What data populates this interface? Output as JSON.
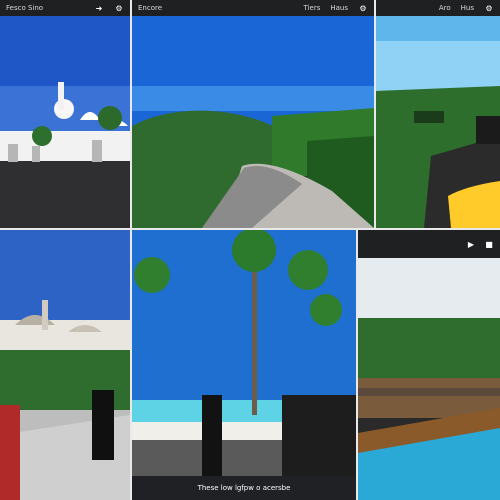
{
  "panels": [
    {
      "toolbar": {
        "label_left": "Fesco Sino",
        "label_right": ""
      }
    },
    {
      "toolbar": {
        "label_left": "Encore",
        "label_mid": "Tiers",
        "label_right": "Haus"
      }
    },
    {
      "toolbar": {
        "label_left": "",
        "label_mid": "Aro",
        "label_right": "Hus"
      }
    },
    {
      "caption": "These low lgfpw o acersbe"
    }
  ],
  "icons": [
    "arrow-icon",
    "gear-icon",
    "play-icon",
    "stop-icon"
  ],
  "colors": {
    "toolbar_bg": "#1f2022",
    "sky": "#1e6fd0",
    "sea": "#5fd3e6"
  }
}
